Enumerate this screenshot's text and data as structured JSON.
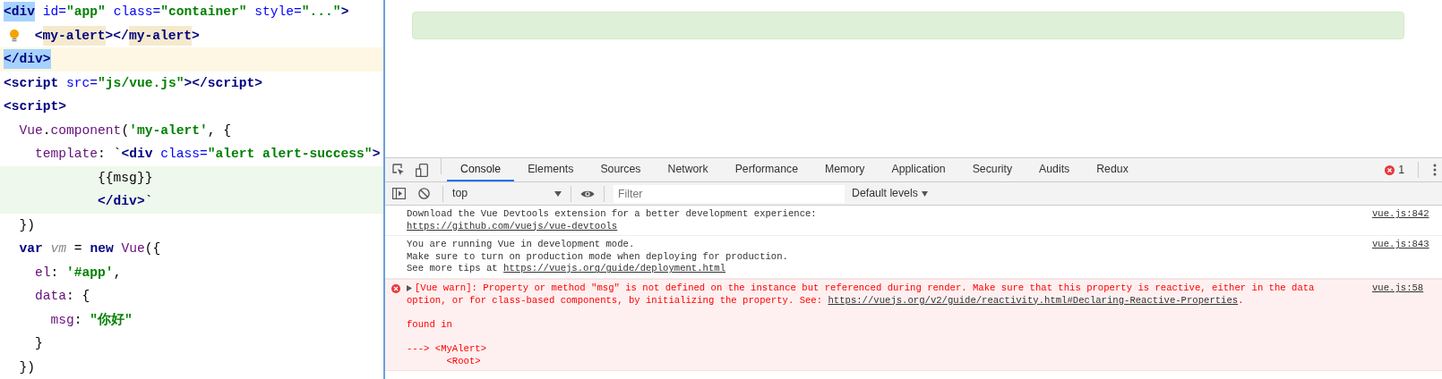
{
  "editor": {
    "lines": [
      {
        "current": false,
        "injected": false,
        "bulb": false,
        "tokens": [
          {
            "text": "<div",
            "kind": "tag",
            "selected": true,
            "highlighted": false
          },
          {
            "text": " id=",
            "kind": "attr",
            "selected": false,
            "highlighted": false
          },
          {
            "text": "\"app\"",
            "kind": "str",
            "selected": false,
            "highlighted": false
          },
          {
            "text": " class=",
            "kind": "attr",
            "selected": false,
            "highlighted": false
          },
          {
            "text": "\"container\"",
            "kind": "str",
            "selected": false,
            "highlighted": false
          },
          {
            "text": " style=",
            "kind": "attr",
            "selected": false,
            "highlighted": false
          },
          {
            "text": "\"...\"",
            "kind": "str",
            "selected": false,
            "highlighted": false
          },
          {
            "text": ">",
            "kind": "tag",
            "selected": false,
            "highlighted": false
          }
        ]
      },
      {
        "current": false,
        "injected": false,
        "bulb": true,
        "tokens": [
          {
            "text": "    <",
            "kind": "tag",
            "selected": false,
            "highlighted": false
          },
          {
            "text": "my-alert",
            "kind": "tag",
            "selected": false,
            "highlighted": true
          },
          {
            "text": "></",
            "kind": "tag",
            "selected": false,
            "highlighted": false
          },
          {
            "text": "my-alert",
            "kind": "tag",
            "selected": false,
            "highlighted": true
          },
          {
            "text": ">",
            "kind": "tag",
            "selected": false,
            "highlighted": false
          }
        ]
      },
      {
        "current": true,
        "injected": false,
        "bulb": false,
        "tokens": [
          {
            "text": "</div>",
            "kind": "tag",
            "selected": true,
            "highlighted": false
          }
        ]
      },
      {
        "current": false,
        "injected": false,
        "bulb": false,
        "tokens": [
          {
            "text": "<script",
            "kind": "tag",
            "selected": false,
            "highlighted": false
          },
          {
            "text": " src=",
            "kind": "attr",
            "selected": false,
            "highlighted": false
          },
          {
            "text": "\"js/vue.js\"",
            "kind": "str",
            "selected": false,
            "highlighted": false
          },
          {
            "text": "></script>",
            "kind": "tag",
            "selected": false,
            "highlighted": false
          }
        ]
      },
      {
        "current": false,
        "injected": false,
        "bulb": false,
        "tokens": [
          {
            "text": "<script>",
            "kind": "tag",
            "selected": false,
            "highlighted": false
          }
        ]
      },
      {
        "current": false,
        "injected": false,
        "bulb": false,
        "tokens": [
          {
            "text": "  Vue",
            "kind": "fn",
            "selected": false,
            "highlighted": false
          },
          {
            "text": ".",
            "kind": "plain",
            "selected": false,
            "highlighted": false
          },
          {
            "text": "component",
            "kind": "fn",
            "selected": false,
            "highlighted": false
          },
          {
            "text": "(",
            "kind": "plain",
            "selected": false,
            "highlighted": false
          },
          {
            "text": "'my-alert'",
            "kind": "str",
            "selected": false,
            "highlighted": false
          },
          {
            "text": ", {",
            "kind": "plain",
            "selected": false,
            "highlighted": false
          }
        ]
      },
      {
        "current": false,
        "injected": false,
        "bulb": false,
        "tokens": [
          {
            "text": "    template",
            "kind": "prop",
            "selected": false,
            "highlighted": false
          },
          {
            "text": ": `",
            "kind": "plain",
            "selected": false,
            "highlighted": false
          },
          {
            "text": "<div",
            "kind": "tag",
            "selected": false,
            "highlighted": false
          },
          {
            "text": " class=",
            "kind": "attr",
            "selected": false,
            "highlighted": false
          },
          {
            "text": "\"alert alert-success\"",
            "kind": "str",
            "selected": false,
            "highlighted": false
          },
          {
            "text": ">",
            "kind": "tag",
            "selected": false,
            "highlighted": false
          }
        ]
      },
      {
        "current": false,
        "injected": true,
        "bulb": false,
        "tokens": [
          {
            "text": "            {{msg}}",
            "kind": "plain",
            "selected": false,
            "highlighted": false
          }
        ]
      },
      {
        "current": false,
        "injected": true,
        "bulb": false,
        "tokens": [
          {
            "text": "            </div>",
            "kind": "tag",
            "selected": false,
            "highlighted": false
          },
          {
            "text": "`",
            "kind": "plain",
            "selected": false,
            "highlighted": false
          }
        ]
      },
      {
        "current": false,
        "injected": false,
        "bulb": false,
        "tokens": [
          {
            "text": "  })",
            "kind": "plain",
            "selected": false,
            "highlighted": false
          }
        ]
      },
      {
        "current": false,
        "injected": false,
        "bulb": false,
        "tokens": [
          {
            "text": "  var",
            "kind": "kw",
            "selected": false,
            "highlighted": false
          },
          {
            "text": " vm",
            "kind": "local",
            "selected": false,
            "highlighted": false
          },
          {
            "text": " =",
            "kind": "plain",
            "selected": false,
            "highlighted": false
          },
          {
            "text": " new",
            "kind": "kw",
            "selected": false,
            "highlighted": false
          },
          {
            "text": " Vue",
            "kind": "fn",
            "selected": false,
            "highlighted": false
          },
          {
            "text": "({",
            "kind": "plain",
            "selected": false,
            "highlighted": false
          }
        ]
      },
      {
        "current": false,
        "injected": false,
        "bulb": false,
        "tokens": [
          {
            "text": "    el",
            "kind": "prop",
            "selected": false,
            "highlighted": false
          },
          {
            "text": ":",
            "kind": "plain",
            "selected": false,
            "highlighted": false
          },
          {
            "text": " '#app'",
            "kind": "str",
            "selected": false,
            "highlighted": false
          },
          {
            "text": ",",
            "kind": "plain",
            "selected": false,
            "highlighted": false
          }
        ]
      },
      {
        "current": false,
        "injected": false,
        "bulb": false,
        "tokens": [
          {
            "text": "    data",
            "kind": "prop",
            "selected": false,
            "highlighted": false
          },
          {
            "text": ": {",
            "kind": "plain",
            "selected": false,
            "highlighted": false
          }
        ]
      },
      {
        "current": false,
        "injected": false,
        "bulb": false,
        "tokens": [
          {
            "text": "      msg",
            "kind": "prop",
            "selected": false,
            "highlighted": false
          },
          {
            "text": ":",
            "kind": "plain",
            "selected": false,
            "highlighted": false
          },
          {
            "text": " \"你好\"",
            "kind": "str",
            "selected": false,
            "highlighted": false
          }
        ]
      },
      {
        "current": false,
        "injected": false,
        "bulb": false,
        "tokens": [
          {
            "text": "    }",
            "kind": "plain",
            "selected": false,
            "highlighted": false
          }
        ]
      },
      {
        "current": false,
        "injected": false,
        "bulb": false,
        "tokens": [
          {
            "text": "  })",
            "kind": "plain",
            "selected": false,
            "highlighted": false
          }
        ]
      }
    ]
  },
  "devtools": {
    "tabs": [
      {
        "label": "Console",
        "selected": true
      },
      {
        "label": "Elements",
        "selected": false
      },
      {
        "label": "Sources",
        "selected": false
      },
      {
        "label": "Network",
        "selected": false
      },
      {
        "label": "Performance",
        "selected": false
      },
      {
        "label": "Memory",
        "selected": false
      },
      {
        "label": "Application",
        "selected": false
      },
      {
        "label": "Security",
        "selected": false
      },
      {
        "label": "Audits",
        "selected": false
      },
      {
        "label": "Redux",
        "selected": false
      }
    ],
    "error_count": "1",
    "context": "top",
    "filter": {
      "placeholder": "Filter"
    },
    "levels": "Default levels",
    "messages": [
      {
        "kind": "info",
        "source": "vue.js:842",
        "blocks": [
          [
            [
              {
                "text": "Download the Vue Devtools extension for a better development experience:",
                "link": false
              }
            ],
            [
              {
                "text": "https://github.com/vuejs/vue-devtools",
                "link": true
              }
            ]
          ]
        ]
      },
      {
        "kind": "info",
        "source": "vue.js:843",
        "blocks": [
          [
            [
              {
                "text": "You are running Vue in development mode.",
                "link": false
              }
            ],
            [
              {
                "text": "Make sure to turn on production mode when deploying for production.",
                "link": false
              }
            ],
            [
              {
                "text": "See more tips at ",
                "link": false
              },
              {
                "text": "https://vuejs.org/guide/deployment.html",
                "link": true
              }
            ]
          ]
        ]
      },
      {
        "kind": "error",
        "source": "vue.js:58",
        "blocks": [
          [
            [
              {
                "text": "[Vue warn]: Property or method \"msg\" is not defined on the instance but referenced during render. Make sure that this property is reactive, either in the data",
                "link": false
              }
            ],
            [
              {
                "text": "option, or for class-based components, by initializing the property. See: ",
                "link": false
              },
              {
                "text": "https://vuejs.org/v2/guide/reactivity.html#Declaring-Reactive-Properties",
                "link": true
              },
              {
                "text": ".",
                "link": false
              }
            ]
          ],
          [
            [
              {
                "text": "found in",
                "link": false
              }
            ]
          ],
          [
            [
              {
                "text": "---> <MyAlert>",
                "link": false
              }
            ],
            [
              {
                "text": "       <Root>",
                "link": false
              }
            ]
          ]
        ]
      }
    ]
  }
}
